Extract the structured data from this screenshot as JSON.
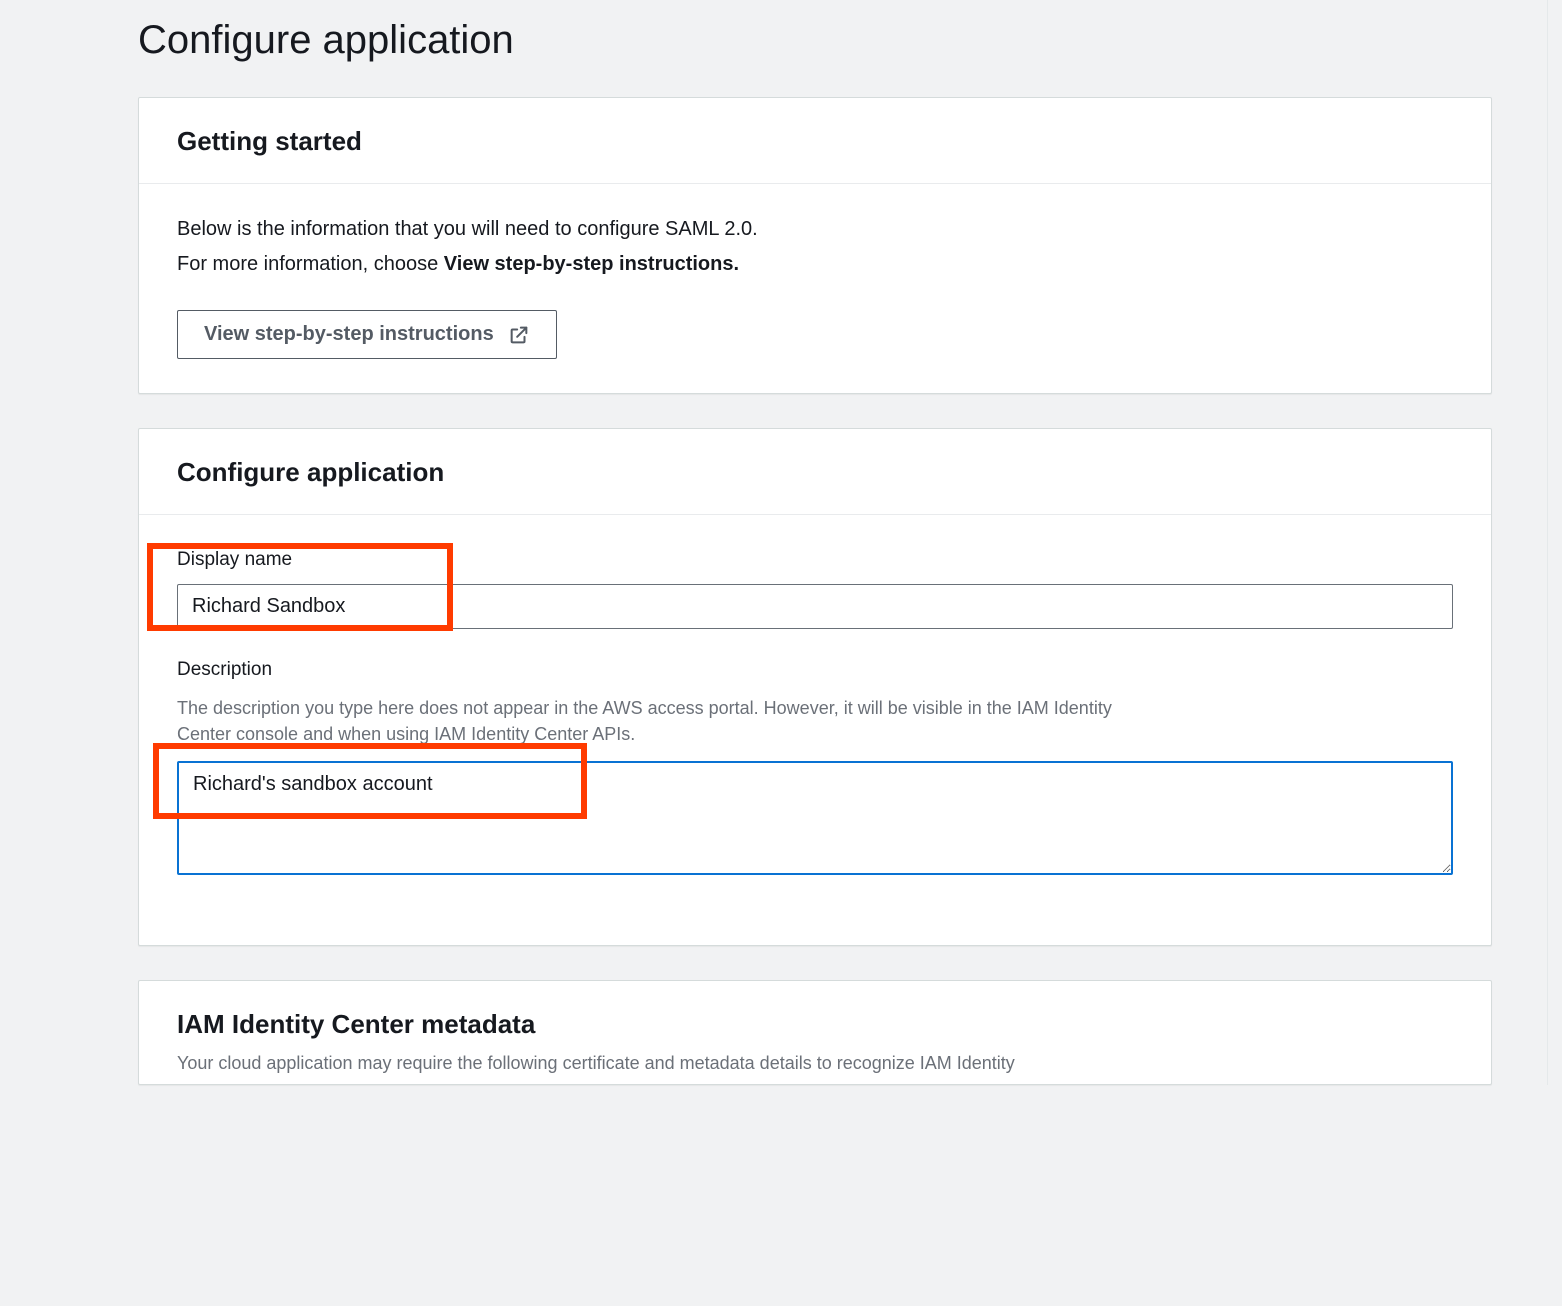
{
  "page": {
    "title": "Configure application"
  },
  "getting_started": {
    "heading": "Getting started",
    "line1": "Below is the information that you will need to configure SAML 2.0.",
    "line2_pre": "For more information, choose ",
    "line2_bold": "View step-by-step instructions.",
    "button_label": "View step-by-step instructions"
  },
  "configure": {
    "heading": "Configure application",
    "display_name_label": "Display name",
    "display_name_value": "Richard Sandbox",
    "description_label": "Description",
    "description_hint": "The description you type here does not appear in the AWS access portal. However, it will be visible in the IAM Identity Center console and when using IAM Identity Center APIs.",
    "description_value": "Richard's sandbox account"
  },
  "metadata": {
    "heading": "IAM Identity Center metadata",
    "sub": "Your cloud application may require the following certificate and metadata details to recognize IAM Identity"
  }
}
